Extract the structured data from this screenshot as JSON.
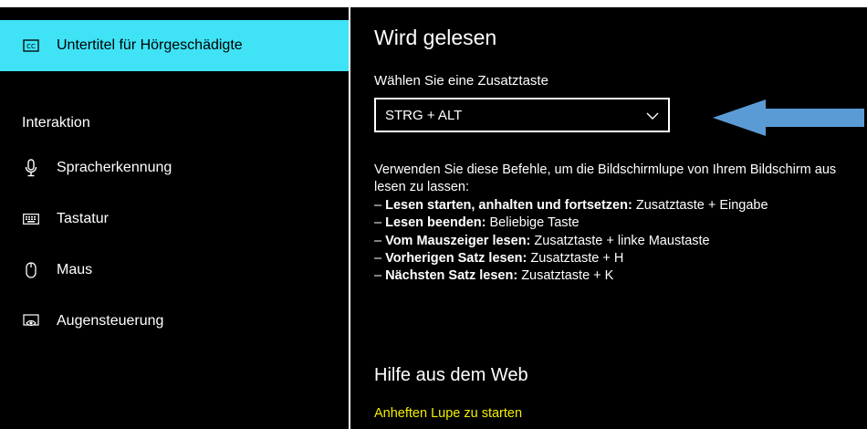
{
  "sidebar": {
    "items": [
      {
        "label": "Untertitel für Hörgeschädigte",
        "icon": "closed-captions-icon",
        "selected": true
      },
      {
        "label": "Spracherkennung",
        "icon": "microphone-icon",
        "selected": false
      },
      {
        "label": "Tastatur",
        "icon": "keyboard-icon",
        "selected": false
      },
      {
        "label": "Maus",
        "icon": "mouse-icon",
        "selected": false
      },
      {
        "label": "Augensteuerung",
        "icon": "eye-control-icon",
        "selected": false
      }
    ],
    "section_label": "Interaktion"
  },
  "main": {
    "title": "Wird gelesen",
    "modifier_label": "Wählen Sie eine Zusatztaste",
    "modifier_value": "STRG + ALT",
    "intro": "Verwenden Sie diese Befehle, um die Bildschirmlupe von Ihrem Bildschirm aus lesen zu lassen:",
    "commands": [
      {
        "name": "Lesen starten, anhalten und fortsetzen:",
        "keys": "Zusatztaste + Eingabe"
      },
      {
        "name": "Lesen beenden:",
        "keys": "Beliebige Taste"
      },
      {
        "name": "Vom Mauszeiger lesen:",
        "keys": "Zusatztaste + linke Maustaste"
      },
      {
        "name": "Vorherigen Satz lesen:",
        "keys": "Zusatztaste + H"
      },
      {
        "name": "Nächsten Satz lesen:",
        "keys": "Zusatztaste + K"
      }
    ],
    "help_title": "Hilfe aus dem Web",
    "help_link": "Anheften Lupe zu starten"
  },
  "colors": {
    "accent": "#3fe3f5",
    "background": "#000000",
    "text": "#ffffff",
    "link": "#f2ee00",
    "arrow": "#5b9bd5"
  }
}
